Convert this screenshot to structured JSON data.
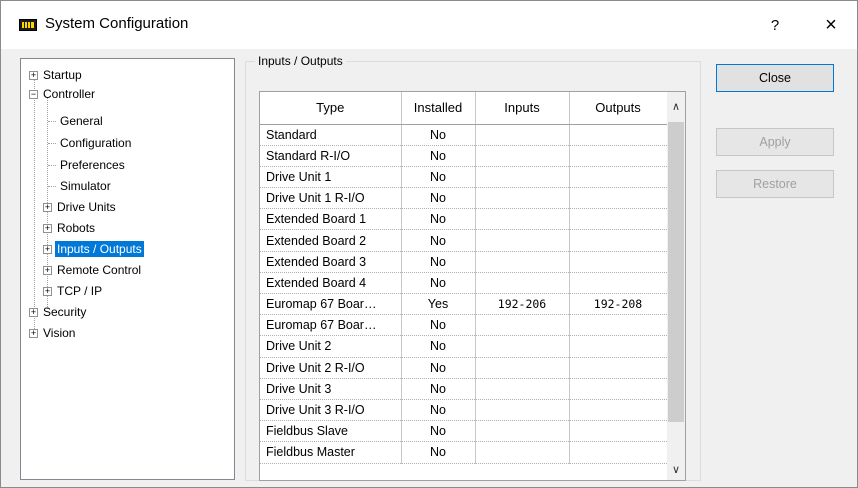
{
  "window": {
    "title": "System Configuration",
    "help_label": "?",
    "close_label": "×"
  },
  "tree": {
    "items": [
      {
        "label": "Startup",
        "expander": "+"
      },
      {
        "label": "Controller",
        "expander": "−"
      },
      {
        "label": "General"
      },
      {
        "label": "Configuration"
      },
      {
        "label": "Preferences"
      },
      {
        "label": "Simulator"
      },
      {
        "label": "Drive Units",
        "expander": "+"
      },
      {
        "label": "Robots",
        "expander": "+"
      },
      {
        "label": "Inputs / Outputs",
        "expander": "+",
        "selected": true
      },
      {
        "label": "Remote Control",
        "expander": "+"
      },
      {
        "label": "TCP / IP",
        "expander": "+"
      },
      {
        "label": "Security",
        "expander": "+"
      },
      {
        "label": "Vision",
        "expander": "+"
      }
    ]
  },
  "io_group": {
    "title": "Inputs / Outputs",
    "columns": [
      "Type",
      "Installed",
      "Inputs",
      "Outputs"
    ],
    "rows": [
      {
        "type": "Standard",
        "installed": "No",
        "inputs": "",
        "outputs": ""
      },
      {
        "type": "Standard R-I/O",
        "installed": "No",
        "inputs": "",
        "outputs": ""
      },
      {
        "type": "Drive Unit 1",
        "installed": "No",
        "inputs": "",
        "outputs": ""
      },
      {
        "type": "Drive Unit 1 R-I/O",
        "installed": "No",
        "inputs": "",
        "outputs": ""
      },
      {
        "type": "Extended Board 1",
        "installed": "No",
        "inputs": "",
        "outputs": ""
      },
      {
        "type": "Extended Board 2",
        "installed": "No",
        "inputs": "",
        "outputs": ""
      },
      {
        "type": "Extended Board 3",
        "installed": "No",
        "inputs": "",
        "outputs": ""
      },
      {
        "type": "Extended Board 4",
        "installed": "No",
        "inputs": "",
        "outputs": ""
      },
      {
        "type": "Euromap 67 Boar…",
        "installed": "Yes",
        "inputs": "192-206",
        "outputs": "192-208"
      },
      {
        "type": "Euromap 67 Boar…",
        "installed": "No",
        "inputs": "",
        "outputs": ""
      },
      {
        "type": "Drive Unit 2",
        "installed": "No",
        "inputs": "",
        "outputs": ""
      },
      {
        "type": "Drive Unit 2 R-I/O",
        "installed": "No",
        "inputs": "",
        "outputs": ""
      },
      {
        "type": "Drive Unit 3",
        "installed": "No",
        "inputs": "",
        "outputs": ""
      },
      {
        "type": "Drive Unit 3 R-I/O",
        "installed": "No",
        "inputs": "",
        "outputs": ""
      },
      {
        "type": "Fieldbus Slave",
        "installed": "No",
        "inputs": "",
        "outputs": ""
      },
      {
        "type": "Fieldbus Master",
        "installed": "No",
        "inputs": "",
        "outputs": ""
      }
    ]
  },
  "buttons": {
    "close": "Close",
    "apply": "Apply",
    "restore": "Restore"
  },
  "icons": {
    "app": "yellow-io-board-icon",
    "scroll_up": "chevron-up-icon",
    "scroll_down": "chevron-down-icon"
  },
  "colors": {
    "selection": "#0078d7",
    "app_icon": "#ffd400"
  }
}
